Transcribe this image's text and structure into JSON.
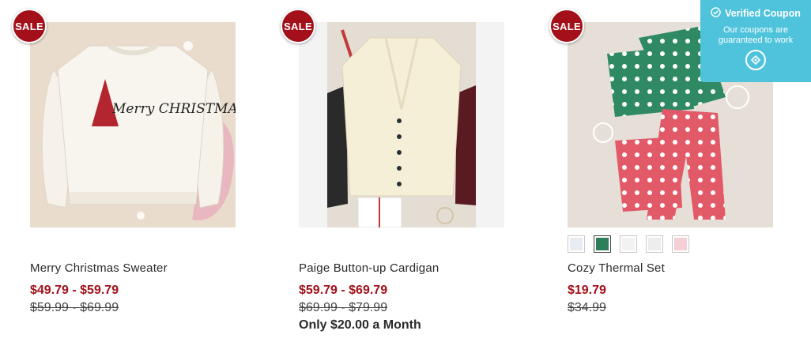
{
  "coupon": {
    "title": "Verified Coupon",
    "subtitle": "Our coupons are guaranteed to work",
    "check_icon": "check-circle-icon",
    "logo_icon": "coupon-logo-icon",
    "color": "#4fc3dc"
  },
  "colors": {
    "sale_red": "#a3101a"
  },
  "products": [
    {
      "badge": "SALE",
      "name": "Merry Christmas Sweater",
      "sale_price": "$49.79 - $59.79",
      "original_price": "$59.99 - $69.99",
      "image_text": "Merry CHRISTMAS"
    },
    {
      "badge": "SALE",
      "name": "Paige Button-up Cardigan",
      "sale_price": "$59.79 - $69.79",
      "original_price": "$69.99 - $79.99",
      "monthly": "Only $20.00 a Month"
    },
    {
      "badge": "SALE",
      "name": "Cozy Thermal Set",
      "sale_price": "$19.79",
      "original_price": "$34.99",
      "swatches": [
        "#e6ecf2",
        "#2e7d5b",
        "#f2f2f2",
        "#ededed",
        "#f4cfd6"
      ]
    }
  ]
}
